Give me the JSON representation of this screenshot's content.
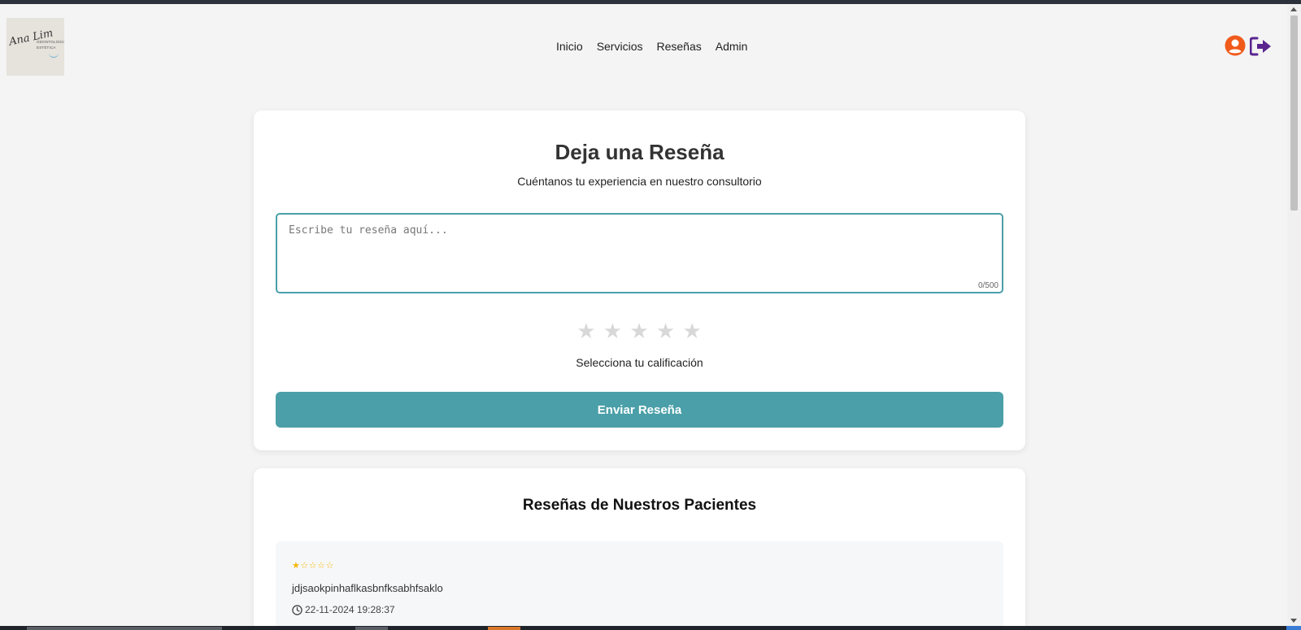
{
  "logo": {
    "script": "Ana Lim",
    "tagline": "ODONTOLOGÍA ESTÉTICA"
  },
  "nav": {
    "items": [
      "Inicio",
      "Servicios",
      "Reseñas",
      "Admin"
    ]
  },
  "header_icons": {
    "user": "user-circle-icon",
    "logout": "logout-icon",
    "user_color": "#f05a1a",
    "logout_color": "#5b2590"
  },
  "review_form": {
    "title": "Deja una Reseña",
    "subtitle": "Cuéntanos tu experiencia en nuestro consultorio",
    "textarea_placeholder": "Escribe tu reseña aquí...",
    "textarea_value": "",
    "char_counter": "0/500",
    "rating_stars": [
      "★",
      "★",
      "★",
      "★",
      "★"
    ],
    "rating_value": 0,
    "rating_label": "Selecciona tu calificación",
    "submit_label": "Enviar Reseña",
    "accent_color": "#4a9fa8"
  },
  "reviews": {
    "title": "Reseñas de Nuestros Pacientes",
    "items": [
      {
        "stars_display": "★☆☆☆☆",
        "rating": 1,
        "text": "jdjsaokpinhaflkasbnfksabhfsaklo",
        "date": "22-11-2024 19:28:37"
      }
    ]
  }
}
